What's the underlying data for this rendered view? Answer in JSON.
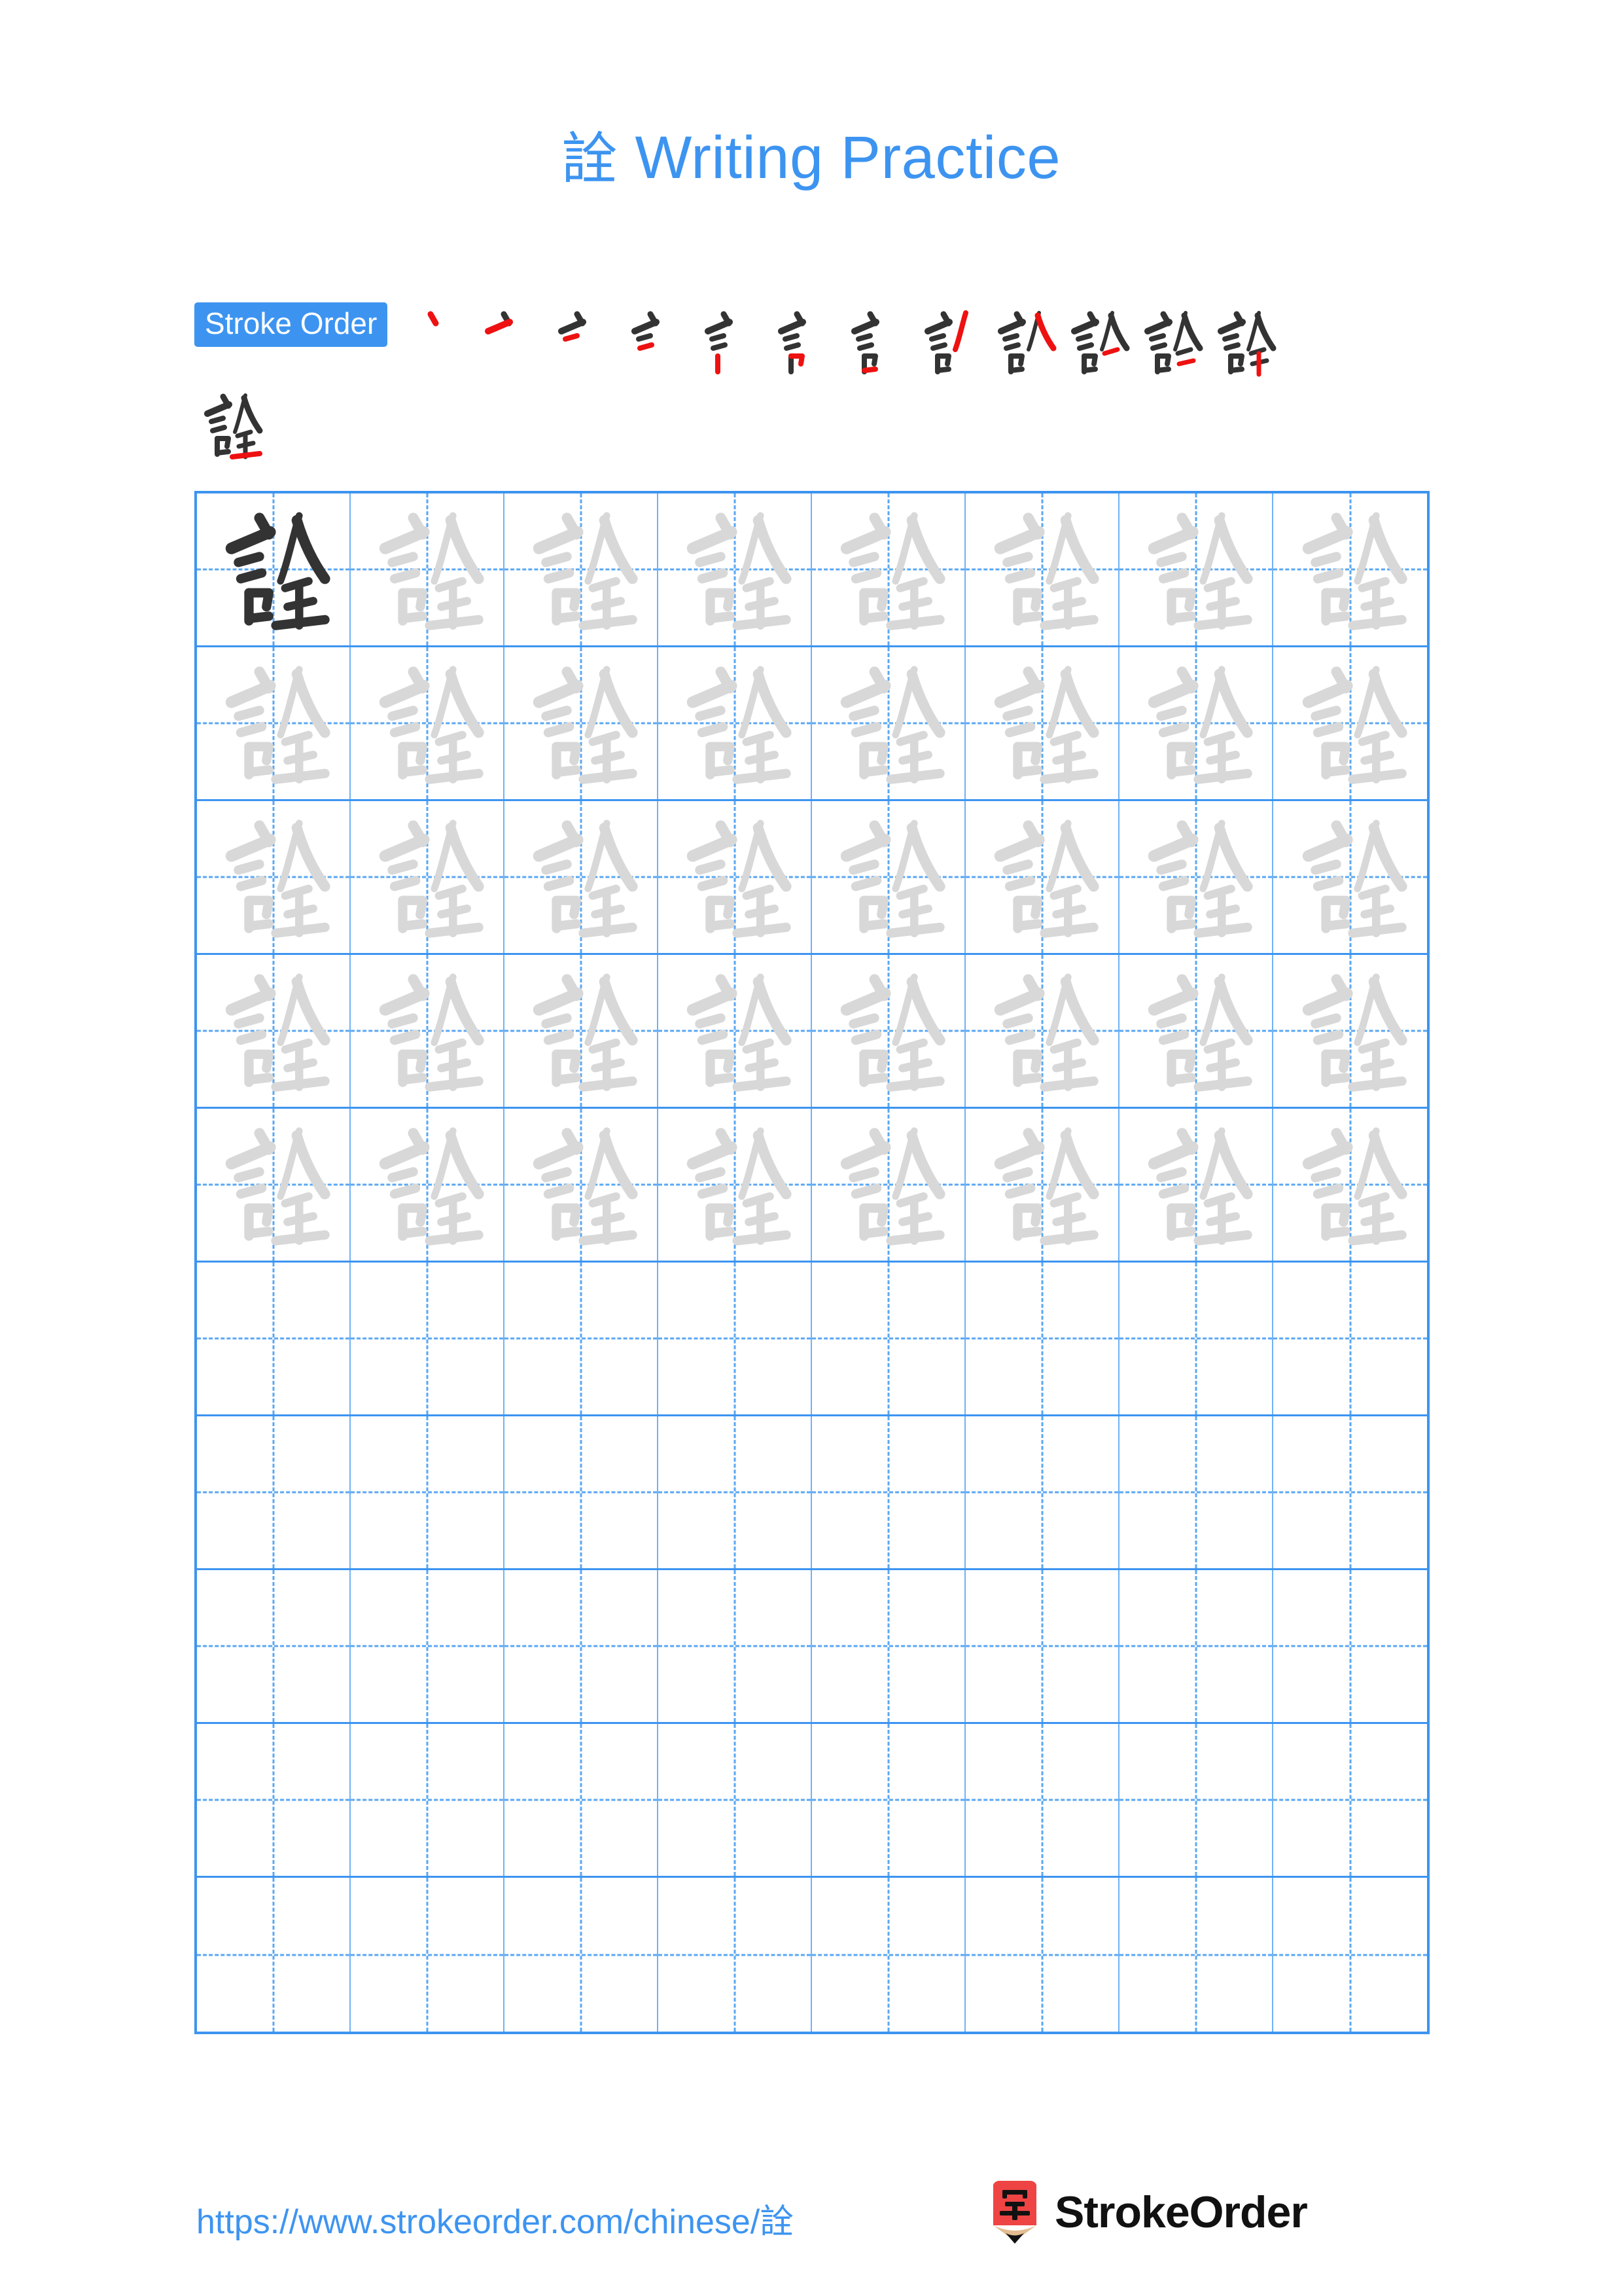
{
  "page": {
    "character": "詮",
    "title": "詮 Writing Practice",
    "title_character": "詮",
    "title_text": " Writing Practice",
    "background_color": "#ffffff",
    "accent_color": "#3d94f0"
  },
  "stroke_order": {
    "badge_label": "Stroke Order",
    "total_strokes": 13,
    "new_stroke_color": "#ee1111",
    "existing_stroke_color": "#333333",
    "steps": [
      {
        "index": 1,
        "label": "stroke-1"
      },
      {
        "index": 2,
        "label": "stroke-2"
      },
      {
        "index": 3,
        "label": "stroke-3"
      },
      {
        "index": 4,
        "label": "stroke-4"
      },
      {
        "index": 5,
        "label": "stroke-5"
      },
      {
        "index": 6,
        "label": "stroke-6"
      },
      {
        "index": 7,
        "label": "stroke-7"
      },
      {
        "index": 8,
        "label": "stroke-8"
      },
      {
        "index": 9,
        "label": "stroke-9"
      },
      {
        "index": 10,
        "label": "stroke-10"
      },
      {
        "index": 11,
        "label": "stroke-11"
      },
      {
        "index": 12,
        "label": "stroke-12"
      },
      {
        "index": 13,
        "label": "stroke-13"
      }
    ]
  },
  "practice_grid": {
    "columns": 8,
    "rows": 10,
    "grid_line_color": "#3d94f0",
    "guide_line_color": "#5aa7f3",
    "model_character_color": "#333333",
    "trace_character_color": "#d8d8d8",
    "rows_data": [
      {
        "row": 1,
        "cells": [
          "model",
          "trace",
          "trace",
          "trace",
          "trace",
          "trace",
          "trace",
          "trace"
        ]
      },
      {
        "row": 2,
        "cells": [
          "trace",
          "trace",
          "trace",
          "trace",
          "trace",
          "trace",
          "trace",
          "trace"
        ]
      },
      {
        "row": 3,
        "cells": [
          "trace",
          "trace",
          "trace",
          "trace",
          "trace",
          "trace",
          "trace",
          "trace"
        ]
      },
      {
        "row": 4,
        "cells": [
          "trace",
          "trace",
          "trace",
          "trace",
          "trace",
          "trace",
          "trace",
          "trace"
        ]
      },
      {
        "row": 5,
        "cells": [
          "trace",
          "trace",
          "trace",
          "trace",
          "trace",
          "trace",
          "trace",
          "trace"
        ]
      },
      {
        "row": 6,
        "cells": [
          "empty",
          "empty",
          "empty",
          "empty",
          "empty",
          "empty",
          "empty",
          "empty"
        ]
      },
      {
        "row": 7,
        "cells": [
          "empty",
          "empty",
          "empty",
          "empty",
          "empty",
          "empty",
          "empty",
          "empty"
        ]
      },
      {
        "row": 8,
        "cells": [
          "empty",
          "empty",
          "empty",
          "empty",
          "empty",
          "empty",
          "empty",
          "empty"
        ]
      },
      {
        "row": 9,
        "cells": [
          "empty",
          "empty",
          "empty",
          "empty",
          "empty",
          "empty",
          "empty",
          "empty"
        ]
      },
      {
        "row": 10,
        "cells": [
          "empty",
          "empty",
          "empty",
          "empty",
          "empty",
          "empty",
          "empty",
          "empty"
        ]
      }
    ]
  },
  "footer": {
    "url_prefix": "https://www.strokeorder.com/chinese/",
    "url_character": "詮",
    "url_full": "https://www.strokeorder.com/chinese/詮",
    "logo_text": "StrokeOrder",
    "logo_glyph": "字",
    "logo_body_color": "#ef4444",
    "logo_wood_color": "#e3bd91"
  }
}
